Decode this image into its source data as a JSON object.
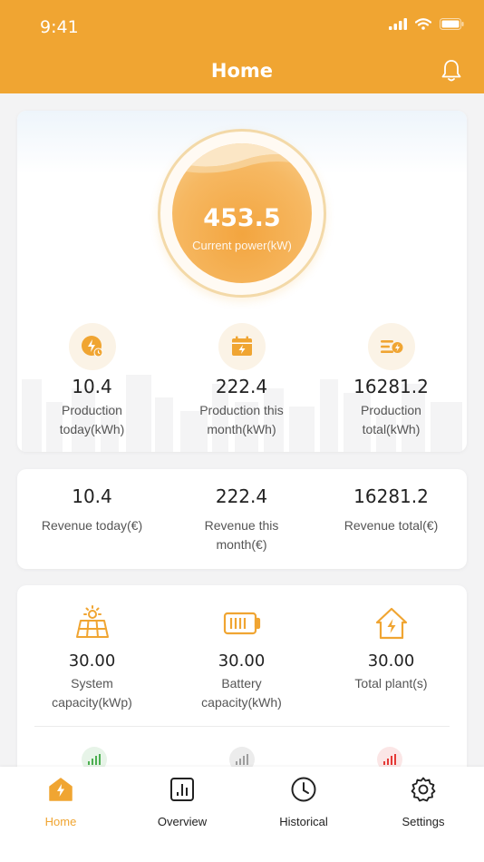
{
  "status_bar": {
    "time": "9:41"
  },
  "header": {
    "title": "Home"
  },
  "gauge": {
    "value": "453.5",
    "label": "Current power(kW)"
  },
  "production": [
    {
      "value": "10.4",
      "label": "Production today(kWh)",
      "icon": "lightning-clock-icon"
    },
    {
      "value": "222.4",
      "label": "Production this month(kWh)",
      "icon": "calendar-lightning-icon"
    },
    {
      "value": "16281.2",
      "label": "Production total(kWh)",
      "icon": "list-lightning-icon"
    }
  ],
  "revenue": [
    {
      "value": "10.4",
      "label": "Revenue today(€)"
    },
    {
      "value": "222.4",
      "label": "Revenue this month(€)"
    },
    {
      "value": "16281.2",
      "label": "Revenue total(€)"
    }
  ],
  "capacity": [
    {
      "value": "30.00",
      "label": "System capacity(kWp)",
      "icon": "solar-panel-icon"
    },
    {
      "value": "30.00",
      "label": "Battery capacity(kWh)",
      "icon": "battery-icon"
    },
    {
      "value": "30.00",
      "label": "Total plant(s)",
      "icon": "house-lightning-icon"
    }
  ],
  "signals": [
    {
      "icon": "signal-green-icon",
      "color": "#4caf50"
    },
    {
      "icon": "signal-gray-icon",
      "color": "#9e9e9e"
    },
    {
      "icon": "signal-red-icon",
      "color": "#e53935"
    }
  ],
  "tabs": [
    {
      "label": "Home",
      "icon": "home-icon",
      "active": true
    },
    {
      "label": "Overview",
      "icon": "chart-bars-icon",
      "active": false
    },
    {
      "label": "Historical",
      "icon": "clock-icon",
      "active": false
    },
    {
      "label": "Settings",
      "icon": "gear-icon",
      "active": false
    }
  ],
  "colors": {
    "accent": "#f0a532",
    "background": "#f3f3f4"
  }
}
